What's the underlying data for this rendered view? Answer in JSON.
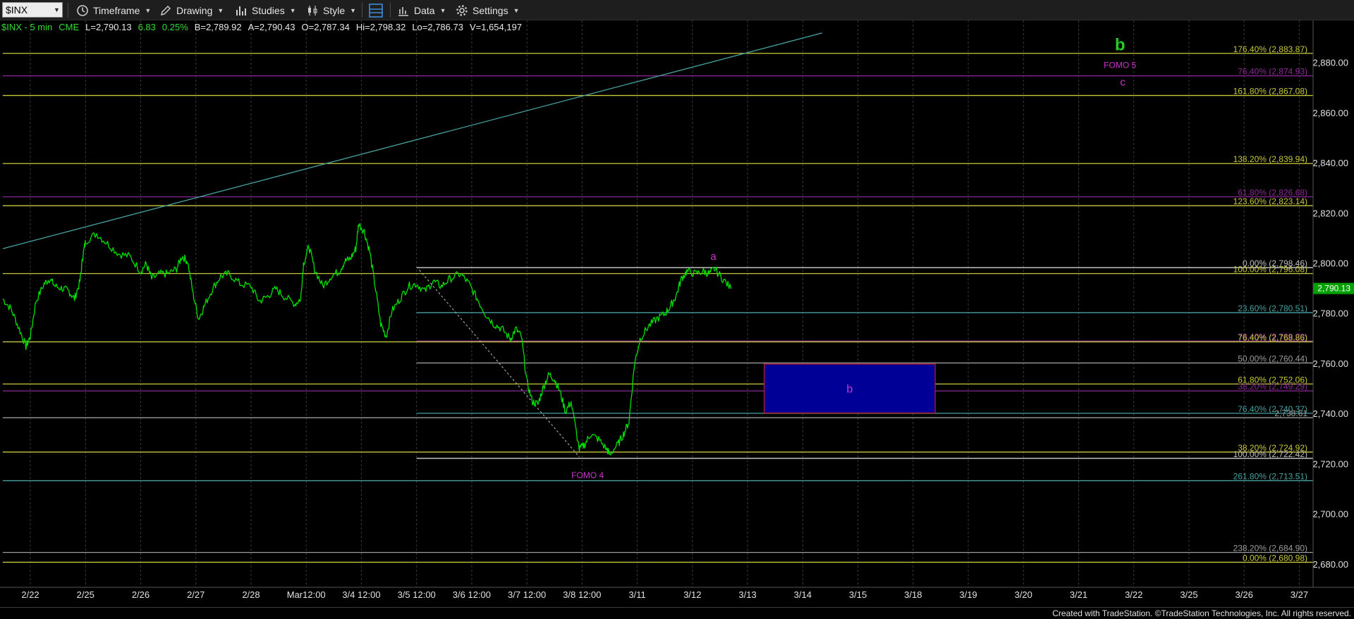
{
  "toolbar": {
    "symbol": "$INX",
    "items": [
      {
        "id": "timeframe",
        "label": "Timeframe",
        "icon": "clock-icon"
      },
      {
        "id": "drawing",
        "label": "Drawing",
        "icon": "pencil-icon"
      },
      {
        "id": "studies",
        "label": "Studies",
        "icon": "bar-chart-icon"
      },
      {
        "id": "style",
        "label": "Style",
        "icon": "candlestick-icon"
      },
      {
        "id": "layout",
        "label": "",
        "icon": "layout-icon"
      },
      {
        "id": "data",
        "label": "Data",
        "icon": "data-icon"
      },
      {
        "id": "settings",
        "label": "Settings",
        "icon": "gear-icon"
      }
    ]
  },
  "info": {
    "symbol": "$INX - 5 min",
    "exchange": "CME",
    "last": "L=2,790.13",
    "change": "6.83",
    "change_pct": "0.25%",
    "bid": "B=2,789.92",
    "ask": "A=2,790.43",
    "open": "O=2,787.34",
    "high": "Hi=2,798.32",
    "low": "Lo=2,786.73",
    "volume": "V=1,654,197"
  },
  "footer": "Created with TradeStation. ©TradeStation Technologies, Inc. All rights reserved.",
  "colors": {
    "background": "#000000",
    "price": "#00e000",
    "magenta": "#cc33cc",
    "yellow": "#c8c83c",
    "white": "#e6e6e6",
    "teal": "#46a0a0",
    "purple": "#8c2896",
    "zone_fill": "#000096",
    "zone_border": "#c81e1e",
    "last_price_badge": "#00a000"
  },
  "chart_data": {
    "type": "line",
    "title": "",
    "xlabel": "",
    "ylabel": "",
    "ylim": [
      2671,
      2897
    ],
    "y_ticks": [
      2680,
      2700,
      2720,
      2740,
      2760,
      2780,
      2800,
      2820,
      2840,
      2860,
      2880
    ],
    "y_tick_labels": [
      "2,680.00",
      "2,700.00",
      "2,720.00",
      "2,740.00",
      "2,760.00",
      "2,780.00",
      "2,800.00",
      "2,820.00",
      "2,840.00",
      "2,860.00",
      "2,880.00"
    ],
    "x_labels": [
      {
        "t": 0.5,
        "label": "2/22"
      },
      {
        "t": 1.5,
        "label": "2/25"
      },
      {
        "t": 2.5,
        "label": "2/26"
      },
      {
        "t": 3.5,
        "label": "2/27"
      },
      {
        "t": 4.5,
        "label": "2/28"
      },
      {
        "t": 5.5,
        "label": "Mar12:00"
      },
      {
        "t": 6.5,
        "label": "3/4 12:00"
      },
      {
        "t": 7.5,
        "label": "3/5 12:00"
      },
      {
        "t": 8.5,
        "label": "3/6 12:00"
      },
      {
        "t": 9.5,
        "label": "3/7 12:00"
      },
      {
        "t": 10.5,
        "label": "3/8 12:00"
      },
      {
        "t": 11.5,
        "label": "3/11"
      },
      {
        "t": 12.5,
        "label": "3/12"
      },
      {
        "t": 13.5,
        "label": "3/13"
      },
      {
        "t": 14.5,
        "label": "3/14"
      },
      {
        "t": 15.5,
        "label": "3/15"
      },
      {
        "t": 16.5,
        "label": "3/18"
      },
      {
        "t": 17.5,
        "label": "3/19"
      },
      {
        "t": 18.5,
        "label": "3/20"
      },
      {
        "t": 19.5,
        "label": "3/21"
      },
      {
        "t": 20.5,
        "label": "3/22"
      },
      {
        "t": 21.5,
        "label": "3/25"
      },
      {
        "t": 22.5,
        "label": "3/26"
      },
      {
        "t": 23.5,
        "label": "3/27"
      }
    ],
    "series": [
      {
        "type": "line",
        "color": "#00e000",
        "points": [
          [
            0.0,
            2786
          ],
          [
            0.15,
            2782
          ],
          [
            0.3,
            2774
          ],
          [
            0.42,
            2767
          ],
          [
            0.5,
            2771
          ],
          [
            0.6,
            2785
          ],
          [
            0.75,
            2792
          ],
          [
            0.85,
            2794
          ],
          [
            0.95,
            2791
          ],
          [
            1.1,
            2790
          ],
          [
            1.2,
            2789
          ],
          [
            1.3,
            2786
          ],
          [
            1.4,
            2793
          ],
          [
            1.45,
            2803
          ],
          [
            1.5,
            2809
          ],
          [
            1.7,
            2812
          ],
          [
            1.9,
            2808
          ],
          [
            2.1,
            2804
          ],
          [
            2.3,
            2803
          ],
          [
            2.5,
            2797
          ],
          [
            2.6,
            2800
          ],
          [
            2.7,
            2794
          ],
          [
            2.85,
            2796
          ],
          [
            3.0,
            2796
          ],
          [
            3.15,
            2798
          ],
          [
            3.25,
            2803
          ],
          [
            3.35,
            2801
          ],
          [
            3.45,
            2788
          ],
          [
            3.55,
            2778
          ],
          [
            3.65,
            2783
          ],
          [
            3.8,
            2790
          ],
          [
            3.95,
            2795
          ],
          [
            4.1,
            2796
          ],
          [
            4.3,
            2792
          ],
          [
            4.5,
            2791
          ],
          [
            4.65,
            2785
          ],
          [
            4.8,
            2787
          ],
          [
            4.95,
            2790
          ],
          [
            5.1,
            2787
          ],
          [
            5.3,
            2784
          ],
          [
            5.4,
            2786
          ],
          [
            5.45,
            2800
          ],
          [
            5.55,
            2807
          ],
          [
            5.65,
            2798
          ],
          [
            5.8,
            2791
          ],
          [
            5.95,
            2795
          ],
          [
            6.1,
            2797
          ],
          [
            6.2,
            2801
          ],
          [
            6.3,
            2802
          ],
          [
            6.4,
            2806
          ],
          [
            6.45,
            2816
          ],
          [
            6.55,
            2813
          ],
          [
            6.65,
            2805
          ],
          [
            6.75,
            2791
          ],
          [
            6.85,
            2776
          ],
          [
            6.95,
            2771
          ],
          [
            7.05,
            2781
          ],
          [
            7.2,
            2786
          ],
          [
            7.35,
            2791
          ],
          [
            7.5,
            2792
          ],
          [
            7.65,
            2789
          ],
          [
            7.8,
            2793
          ],
          [
            7.95,
            2791
          ],
          [
            8.1,
            2794
          ],
          [
            8.3,
            2796
          ],
          [
            8.45,
            2792
          ],
          [
            8.6,
            2786
          ],
          [
            8.75,
            2780
          ],
          [
            8.9,
            2776
          ],
          [
            9.05,
            2774
          ],
          [
            9.2,
            2770
          ],
          [
            9.3,
            2774
          ],
          [
            9.4,
            2771
          ],
          [
            9.5,
            2753
          ],
          [
            9.6,
            2745
          ],
          [
            9.7,
            2744
          ],
          [
            9.8,
            2751
          ],
          [
            9.9,
            2756
          ],
          [
            10.0,
            2754
          ],
          [
            10.1,
            2749
          ],
          [
            10.2,
            2741
          ],
          [
            10.3,
            2745
          ],
          [
            10.45,
            2726
          ],
          [
            10.55,
            2728
          ],
          [
            10.65,
            2732
          ],
          [
            10.8,
            2730
          ],
          [
            10.95,
            2726
          ],
          [
            11.0,
            2724
          ],
          [
            11.15,
            2728
          ],
          [
            11.25,
            2732
          ],
          [
            11.35,
            2737
          ],
          [
            11.45,
            2760
          ],
          [
            11.55,
            2770
          ],
          [
            11.7,
            2775
          ],
          [
            11.85,
            2778
          ],
          [
            12.0,
            2780
          ],
          [
            12.1,
            2783
          ],
          [
            12.2,
            2787
          ],
          [
            12.3,
            2794
          ],
          [
            12.4,
            2797
          ],
          [
            12.55,
            2796
          ],
          [
            12.7,
            2797
          ],
          [
            12.8,
            2796
          ],
          [
            12.9,
            2798
          ],
          [
            13.05,
            2794
          ],
          [
            13.2,
            2790
          ]
        ]
      }
    ],
    "horizontal_lines": [
      {
        "value": 2883.87,
        "color": "#c8c83c",
        "x_start": 0,
        "label": "176.40% (2,883.87)"
      },
      {
        "value": 2874.93,
        "color": "#8c2896",
        "x_start": 0,
        "label": "76.40% (2,874.93)"
      },
      {
        "value": 2867.08,
        "color": "#c8c83c",
        "x_start": 0,
        "label": "161.80% (2,867.08)"
      },
      {
        "value": 2839.94,
        "color": "#c8c83c",
        "x_start": 0,
        "label": "138.20% (2,839.94)"
      },
      {
        "value": 2826.68,
        "color": "#8c2896",
        "x_start": 0,
        "label": "61.80% (2,826.68)"
      },
      {
        "value": 2823.14,
        "color": "#c8c83c",
        "x_start": 0,
        "label": "123.60% (2,823.14)"
      },
      {
        "value": 2798.46,
        "color": "#e6e6e6",
        "x_start": 7.5,
        "label": "0.00% (2,798.46)"
      },
      {
        "value": 2796.08,
        "color": "#c8c83c",
        "x_start": 0,
        "label": "100.00% (2,796.08)"
      },
      {
        "value": 2780.51,
        "color": "#46a0a0",
        "x_start": 7.5,
        "label": "23.60% (2,780.51)"
      },
      {
        "value": 2769.2,
        "color": "#8c2896",
        "x_start": 7.5,
        "label": "76.40% (2,769.20)"
      },
      {
        "value": 2768.86,
        "color": "#c8c83c",
        "x_start": 0,
        "label": "76.40% (2,768.86)"
      },
      {
        "value": 2760.44,
        "color": "#9c9c9c",
        "x_start": 7.5,
        "label": "50.00% (2,760.44)"
      },
      {
        "value": 2752.06,
        "color": "#c8c83c",
        "x_start": 0,
        "label": "61.80% (2,752.06)"
      },
      {
        "value": 2749.29,
        "color": "#8c2896",
        "x_start": 0,
        "label": "38.20% (2,749.29)"
      },
      {
        "value": 2740.37,
        "color": "#46a0a0",
        "x_start": 7.5,
        "label": "76.40% (2,740.37)"
      },
      {
        "value": 2738.61,
        "color": "#9c9c9c",
        "x_start": 0,
        "label": "2,738.61"
      },
      {
        "value": 2724.92,
        "color": "#c8c83c",
        "x_start": 0,
        "label": "38.20% (2,724.92)"
      },
      {
        "value": 2722.42,
        "color": "#e6e6e6",
        "x_start": 7.5,
        "label": "100.00% (2,722.42)"
      },
      {
        "value": 2713.51,
        "color": "#46a0a0",
        "x_start": 0,
        "label": "261.80% (2,713.51)"
      },
      {
        "value": 2684.9,
        "color": "#9c9c9c",
        "x_start": 0,
        "label": "238.20% (2,684.90)"
      },
      {
        "value": 2680.98,
        "color": "#c8c83c",
        "x_start": 0,
        "label": "0.00% (2,680.98)"
      }
    ],
    "trendlines": [
      {
        "from": [
          0.0,
          2806
        ],
        "to": [
          14.85,
          2892
        ],
        "color": "#46a0a0",
        "dashed": false
      },
      {
        "from": [
          7.55,
          2797.5
        ],
        "to": [
          10.45,
          2723
        ],
        "color": "#bbbbbb",
        "dashed": true
      }
    ],
    "zones": [
      {
        "x_range": [
          13.8,
          16.9
        ],
        "y_range": [
          2740.5,
          2760
        ],
        "fill": "#000096",
        "border": "#c81e1e",
        "label": "b"
      }
    ],
    "annotations": [
      {
        "text": "b",
        "x": 20.25,
        "y": 2885,
        "color": "#22d022",
        "size": "large"
      },
      {
        "text": "FOMO 5",
        "x": 20.25,
        "y": 2878,
        "color": "#cc33cc",
        "size": "small"
      },
      {
        "text": "c",
        "x": 20.3,
        "y": 2871,
        "color": "#cc33cc",
        "size": "medium"
      },
      {
        "text": "a",
        "x": 12.88,
        "y": 2801.5,
        "color": "#cc33cc",
        "size": "medium"
      },
      {
        "text": "FOMO 4",
        "x": 10.6,
        "y": 2714.5,
        "color": "#cc33cc",
        "size": "small"
      }
    ],
    "last_price": {
      "value": 2790.13,
      "label": "2,790.13",
      "color": "#00a000"
    },
    "grid": true
  }
}
